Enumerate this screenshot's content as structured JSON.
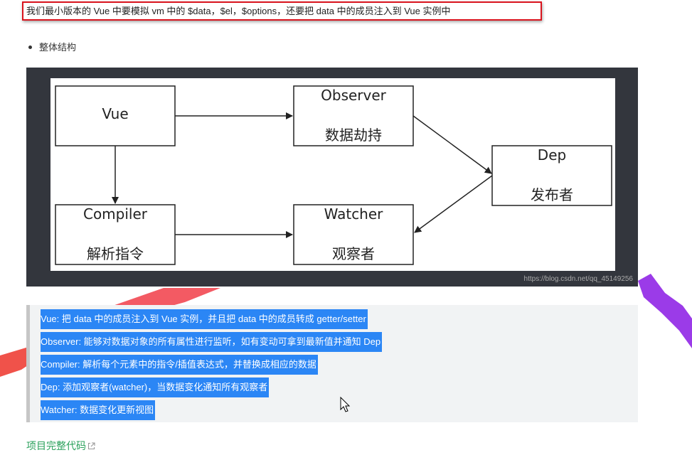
{
  "note": {
    "text": "我们最小版本的 Vue 中要模拟 vm 中的 $data，$el，$options，还要把 data 中的成员注入到 Vue 实例中"
  },
  "bullet": {
    "text": "整体结构"
  },
  "diagram": {
    "boxes": {
      "vue": {
        "title": "Vue"
      },
      "observer": {
        "title": "Observer",
        "subtitle": "数据劫持"
      },
      "dep": {
        "title": "Dep",
        "subtitle": "发布者"
      },
      "compiler": {
        "title": "Compiler",
        "subtitle": "解析指令"
      },
      "watcher": {
        "title": "Watcher",
        "subtitle": "观察者"
      }
    },
    "watermark": "https://blog.csdn.net/qq_45149256"
  },
  "quote": {
    "lines": [
      "Vue: 把 data 中的成员注入到 Vue 实例，并且把 data 中的成员转成 getter/setter",
      "Observer: 能够对数据对象的所有属性进行监听，如有变动可拿到最新值并通知 Dep",
      "Compiler: 解析每个元素中的指令/插值表达式，并替换成相应的数据",
      "Dep: 添加观察者(watcher)，当数据变化通知所有观察者",
      "Watcher: 数据变化更新视图"
    ]
  },
  "footer": {
    "link_text": "项目完整代码"
  },
  "colors": {
    "highlight": "#2b86f5",
    "note_border": "#d9141e",
    "link": "#2aa15b",
    "frame": "#33363d"
  }
}
